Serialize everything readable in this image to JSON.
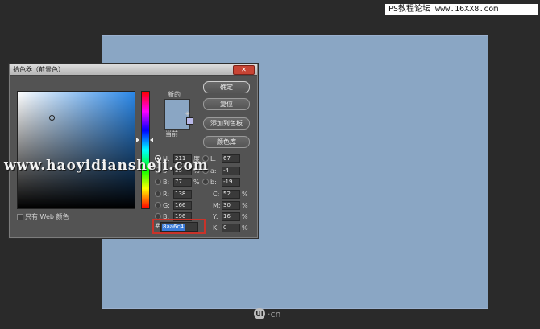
{
  "watermark_top": "PS教程论坛 www.16XX8.com",
  "watermark_mid": "www.haoyidiansheji.com",
  "logo_text": "·cn",
  "canvas_color": "#8aa6c4",
  "dialog": {
    "title": "拾色器（前景色）",
    "close_glyph": "✕",
    "new_label": "新的",
    "current_label": "当前",
    "new_color": "#8aa6c4",
    "current_color": "#8aa6c4",
    "buttons": {
      "ok": "确定",
      "reset": "复位",
      "add_swatch": "添加到色板",
      "libraries": "颜色库"
    },
    "hsb": {
      "h_label": "H:",
      "h_value": "211",
      "h_unit": "度",
      "s_label": "S:",
      "s_value": "30",
      "s_unit": "%",
      "b_label": "B:",
      "b_value": "77",
      "b_unit": "%"
    },
    "rgb": {
      "r_label": "R:",
      "r_value": "138",
      "g_label": "G:",
      "g_value": "166",
      "b_label": "B:",
      "b_value": "196"
    },
    "lab": {
      "l_label": "L:",
      "l_value": "67",
      "a_label": "a:",
      "a_value": "-4",
      "b_label": "b:",
      "b_value": "-19"
    },
    "cmyk": {
      "c_label": "C:",
      "c_value": "52",
      "m_label": "M:",
      "m_value": "30",
      "y_label": "Y:",
      "y_value": "16",
      "k_label": "K:",
      "k_value": "0",
      "unit": "%"
    },
    "hex_label": "#",
    "hex_value": "8aa6c4",
    "web_only_label": "只有 Web 颜色"
  }
}
